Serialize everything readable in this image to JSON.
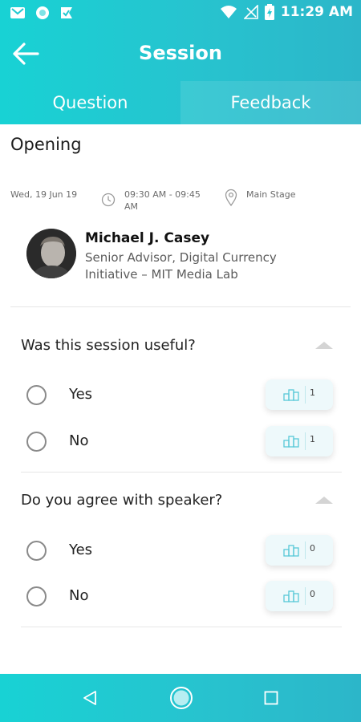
{
  "status_bar": {
    "time": "11:29 AM",
    "left_icons": [
      "gmail-icon",
      "circle-icon",
      "check-flag-icon"
    ],
    "right_icons": [
      "wifi-icon",
      "no-signal-icon",
      "battery-icon"
    ]
  },
  "app_bar": {
    "title": "Session"
  },
  "tabs": [
    {
      "label": "Question",
      "active": false
    },
    {
      "label": "Feedback",
      "active": true
    }
  ],
  "session": {
    "title": "Opening",
    "date": "Wed, 19 Jun 19",
    "time_line1": "09:30 AM - 09:45",
    "time_line2": "AM",
    "location": "Main Stage"
  },
  "speaker": {
    "name": "Michael J. Casey",
    "role_line1": "Senior Advisor, Digital Currency",
    "role_line2": "Initiative – MIT Media Lab"
  },
  "questions": [
    {
      "title": "Was this session useful?",
      "options": [
        {
          "label": "Yes",
          "count": "1"
        },
        {
          "label": "No",
          "count": "1"
        }
      ]
    },
    {
      "title": "Do you agree with speaker?",
      "options": [
        {
          "label": "Yes",
          "count": "0"
        },
        {
          "label": "No",
          "count": "0"
        }
      ]
    }
  ],
  "colors": {
    "header_gradient_start": "#18d2d4",
    "header_gradient_end": "#2cb6c9",
    "vote_icon": "#58c8d8"
  },
  "nav_bar": {
    "buttons": [
      "back-triangle-icon",
      "home-circle-icon",
      "recents-square-icon"
    ]
  }
}
